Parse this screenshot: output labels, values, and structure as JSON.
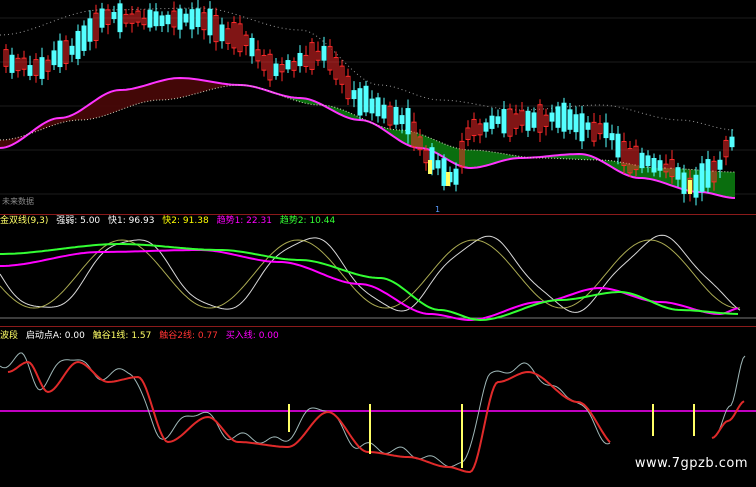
{
  "colors": {
    "background": "#000000",
    "up": "#ff2a2a",
    "down": "#54ffff",
    "ma_magenta": "#ff33ff",
    "ma_white": "#cfcfcf",
    "fill_green": "#0b7a10",
    "fill_red": "#4a0808",
    "separator": "#8b1a1a",
    "yellow": "#ffff66",
    "green_line": "#33ff33",
    "purple_line": "#ff00ff"
  },
  "panel1": {
    "label": "未来数据",
    "marker": "1"
  },
  "panel2": {
    "title": "金双线(9,3)",
    "items": [
      {
        "label": "强弱: 5.00",
        "color": "#ffffff"
      },
      {
        "label": "快1: 96.93",
        "color": "#ffffff"
      },
      {
        "label": "快2: 91.38",
        "color": "#ffff00"
      },
      {
        "label": "趋势1: 22.31",
        "color": "#ff00ff"
      },
      {
        "label": "趋势2: 10.44",
        "color": "#33ff33"
      }
    ]
  },
  "panel3": {
    "title": "波段",
    "items": [
      {
        "label": "启动点A: 0.00",
        "color": "#ffffff"
      },
      {
        "label": "触谷1线: 1.57",
        "color": "#ffff66"
      },
      {
        "label": "触谷2线: 0.77",
        "color": "#ff3333"
      },
      {
        "label": "买入线: 0.00",
        "color": "#ff00ff"
      }
    ]
  },
  "watermark": "www.7gpzb.com"
}
